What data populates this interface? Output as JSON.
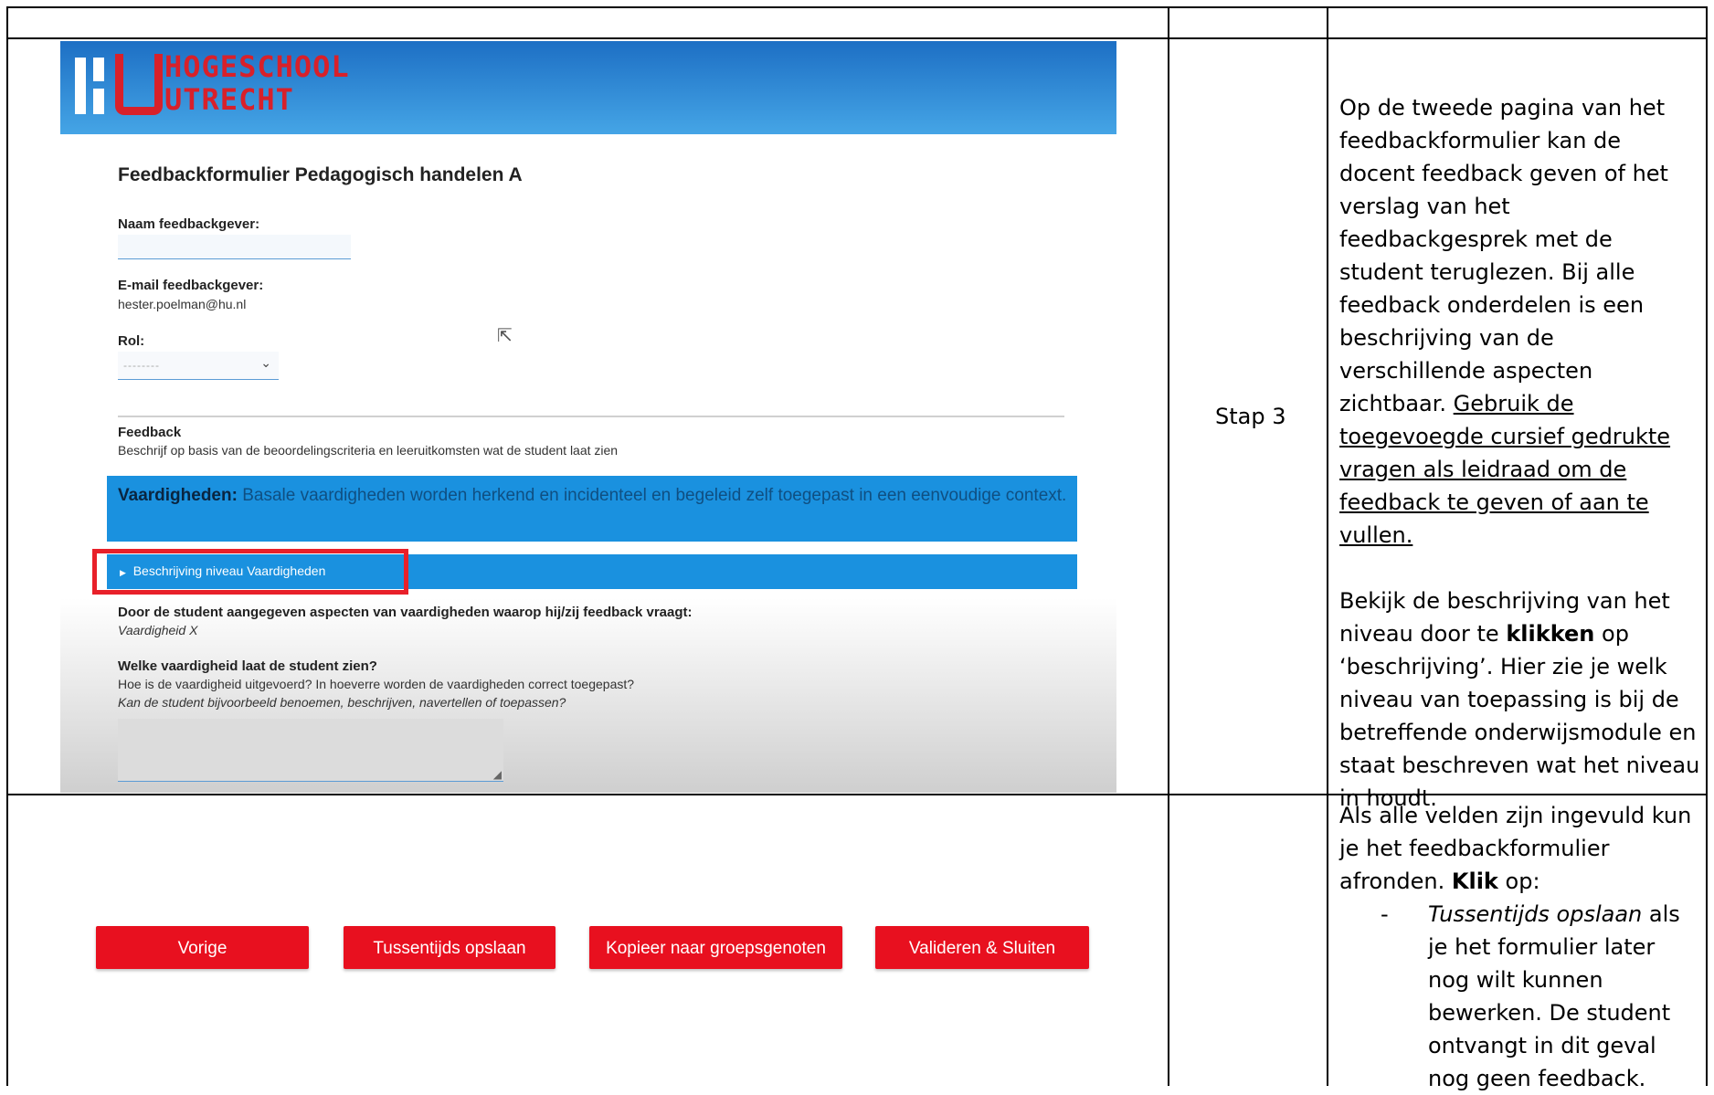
{
  "screenshot": {
    "logo": {
      "line1": "HOGESCHOOL",
      "line2": "UTRECHT"
    },
    "form_title": "Feedbackformulier Pedagogisch handelen A",
    "name_label": "Naam feedbackgever:",
    "email_label": "E-mail feedbackgever:",
    "email_value": "hester.poelman@hu.nl",
    "role_label": "Rol:",
    "role_placeholder": "--------",
    "feedback_heading": "Feedback",
    "feedback_desc": "Beschrijf op basis van de beoordelingscriteria en leeruitkomsten wat de student laat zien",
    "skills_title": "Vaardigheden:",
    "skills_text": "Basale vaardigheden worden herkend en incidenteel en begeleid zelf toegepast in een eenvoudige context.",
    "description_toggle": "Beschrijving niveau Vaardigheden",
    "aspects_label": "Door de student aangegeven aspecten van vaardigheden waarop hij/zij feedback vraagt:",
    "aspects_value": "Vaardigheid X",
    "skill_question": "Welke vaardigheid laat de student zien?",
    "skill_q1": "Hoe is de vaardigheid uitgevoerd? In hoeverre worden de vaardigheden correct toegepast?",
    "skill_q2": "Kan de student bijvoorbeeld benoemen, beschrijven, navertellen of toepassen?"
  },
  "step_label": "Stap 3",
  "instructions": {
    "p1_plain": "Op de tweede pagina van het feedbackformulier kan de docent feedback geven of het verslag van het feedbackgesprek met de student teruglezen. Bij alle feedback onderdelen is een beschrijving van de verschillende aspecten zichtbaar.",
    "p1_underlined": "Gebruik de toegevoegde cursief gedrukte vragen als leidraad om de feedback te geven of aan te vullen.",
    "p2_a": "Bekijk de beschrijving van het niveau door te",
    "p2_bold": "klikken",
    "p2_b": "op ‘beschrijving’. Hier zie je welk niveau van toepassing is bij de betreffende onderwijsmodule en staat beschreven wat het niveau in houdt."
  },
  "buttons": {
    "previous": "Vorige",
    "save_interim": "Tussentijds opslaan",
    "copy_group": "Kopieer naar groepsgenoten",
    "validate_close": "Valideren & Sluiten"
  },
  "instructions2": {
    "intro_a": "Als alle velden zijn ingevuld kun je het feedbackformulier afronden.",
    "intro_bold": "Klik",
    "intro_b": "op:",
    "bullet_dash": "-",
    "bullet_italic": "Tussentijds opslaan",
    "bullet_rest": "als je het formulier later nog wilt kunnen bewerken. De student ontvangt in dit geval nog geen feedback."
  },
  "colors": {
    "accent_red": "#e8101f",
    "hu_blue": "#1a91df",
    "hu_red": "#d8202a"
  }
}
